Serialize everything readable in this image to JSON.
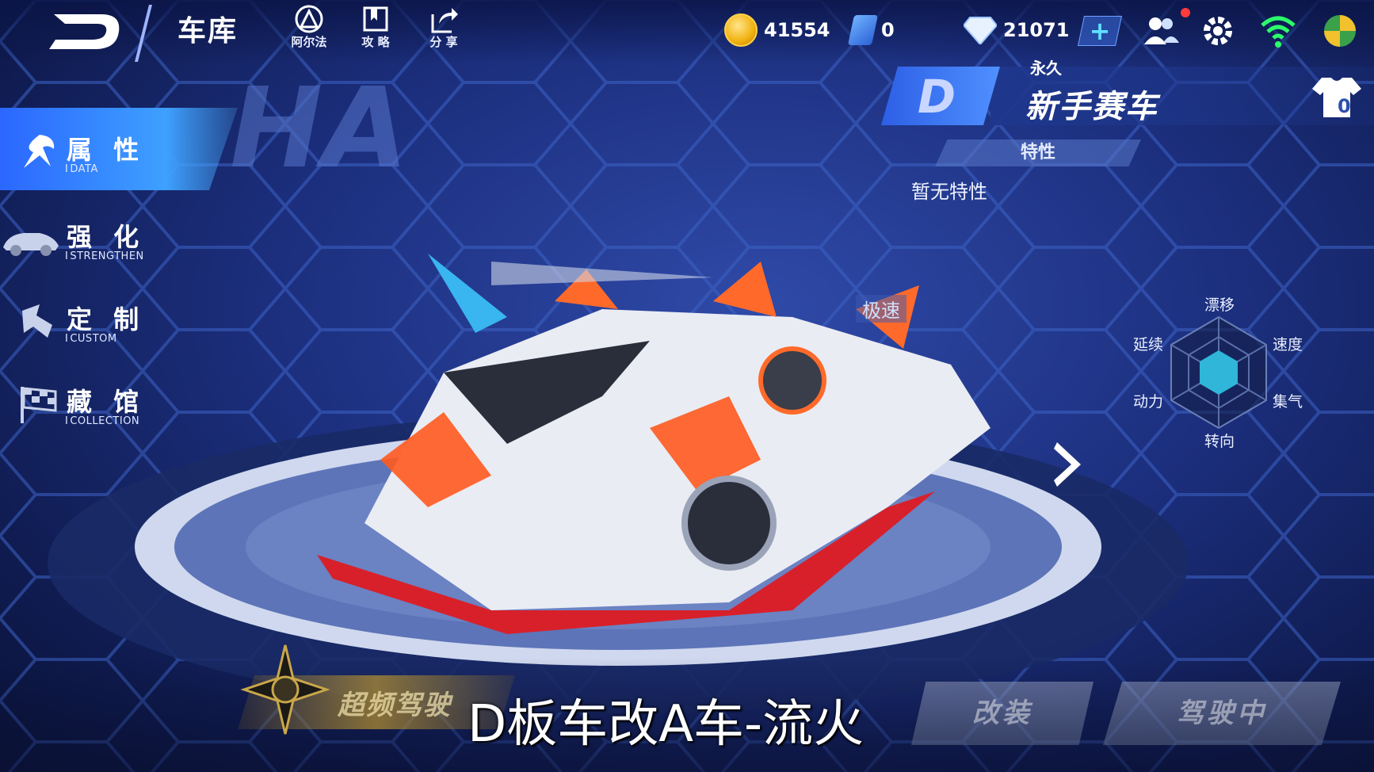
{
  "header": {
    "title": "车库",
    "tools": [
      {
        "label": "阿尔法",
        "icon": "alpha-icon"
      },
      {
        "label": "攻 略",
        "icon": "guide-book-icon"
      },
      {
        "label": "分 享",
        "icon": "share-icon"
      }
    ],
    "coins": "41554",
    "stones": "0",
    "diamonds": "21071",
    "plus": "+"
  },
  "menu": [
    {
      "cn": "属 性",
      "en": "DATA",
      "active": true
    },
    {
      "cn": "强 化",
      "en": "STRENGTHEN",
      "active": false
    },
    {
      "cn": "定 制",
      "en": "CUSTOM",
      "active": false
    },
    {
      "cn": "藏 馆",
      "en": "COLLECTION",
      "active": false
    }
  ],
  "car": {
    "rank": "D",
    "duration": "永久",
    "name": "新手赛车",
    "trait_title": "特性",
    "trait_value": "暂无特性",
    "outfit_count": "0",
    "tag": "极速"
  },
  "radar": {
    "labels": {
      "top": "漂移",
      "upper_right": "速度",
      "lower_right": "集气",
      "bottom": "转向",
      "lower_left": "动力",
      "upper_left": "延续"
    }
  },
  "bottom": {
    "super_label": "超频驾驶",
    "modify": "改装",
    "driving": "驾驶中"
  },
  "caption": "D板车改A车-流火",
  "colors": {
    "accent": "#3ea0ff",
    "radar_fill": "#2fb6d8",
    "car_accent": "#ff5a1f"
  }
}
